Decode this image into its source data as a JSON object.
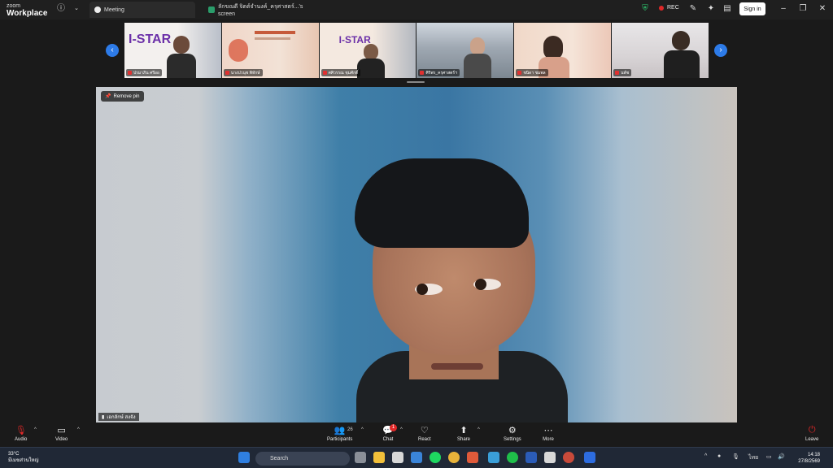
{
  "brand": {
    "small": "zoom",
    "big": "Workplace"
  },
  "tabs": [
    {
      "label": "Meeting"
    },
    {
      "label": "ลักขณดี จิตต์จำนงค์_ครุศาสตร์...'s screen"
    }
  ],
  "rec": "REC",
  "signin": "Sign in",
  "gallery": [
    {
      "name": "ปรมาภิน ศรีผอ"
    },
    {
      "name": "นางปวนุช พิทักษ์"
    },
    {
      "name": "ศศิวรรณ ชุมศักดิ์"
    },
    {
      "name": "ศิริพร_ครุศาสตร์ฯ"
    },
    {
      "name": "ชนิดา ชมพล"
    },
    {
      "name": "นพ์ช"
    }
  ],
  "main": {
    "remove_pin": "Remove pin",
    "speaker": "เอกลักษ์ สงจัง"
  },
  "toolbar": {
    "audio": "Audio",
    "video": "Video",
    "participants": "Participants",
    "participants_count": "26",
    "chat": "Chat",
    "chat_badge": "1",
    "react": "React",
    "share": "Share",
    "settings": "Settings",
    "more": "More",
    "leave": "Leave"
  },
  "taskbar": {
    "temp": "33°C",
    "weather_desc": "มีเมฆส่วนใหญ่",
    "search": "Search",
    "lang": "ไทย",
    "time": "14:18",
    "date": "27/8/2569"
  },
  "colors": {
    "accent": "#2d7be8",
    "rec": "#e02828",
    "leave": "#e02828"
  }
}
